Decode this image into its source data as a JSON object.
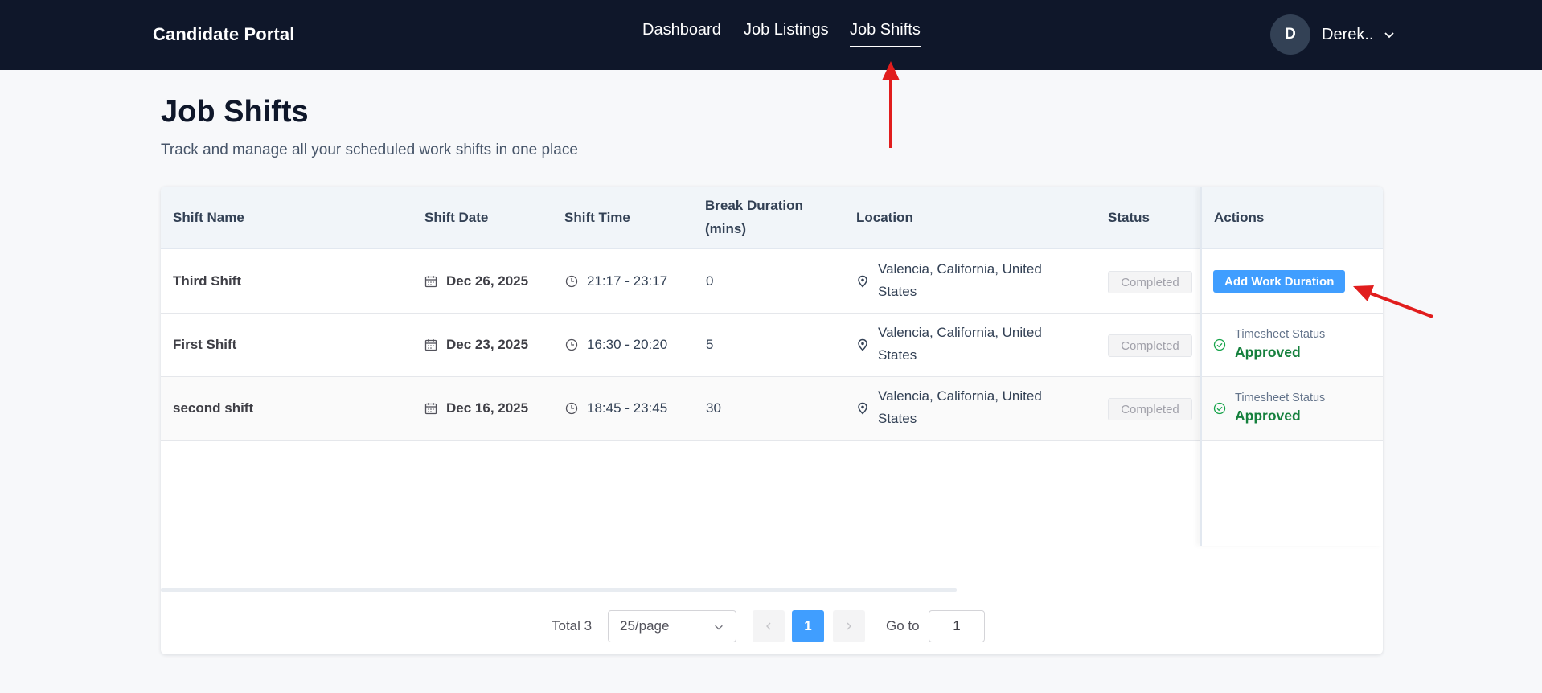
{
  "header": {
    "brand": "Candidate Portal",
    "nav": [
      {
        "label": "Dashboard",
        "active": false
      },
      {
        "label": "Job Listings",
        "active": false
      },
      {
        "label": "Job Shifts",
        "active": true
      }
    ],
    "user": {
      "initial": "D",
      "name": "Derek.."
    }
  },
  "page": {
    "title": "Job Shifts",
    "subtitle": "Track and manage all your scheduled work shifts in one place"
  },
  "table": {
    "columns": {
      "shift_name": "Shift Name",
      "shift_date": "Shift Date",
      "shift_time": "Shift Time",
      "break_duration_line1": "Break Duration",
      "break_duration_line2": "(mins)",
      "location": "Location",
      "status": "Status",
      "actions": "Actions"
    },
    "rows": [
      {
        "name": "Third Shift",
        "date": "Dec 26, 2025",
        "time": "21:17 - 23:17",
        "break": "0",
        "location_line1": "Valencia, California, United",
        "location_line2": "States",
        "status": "Completed",
        "action_button": "Add Work Duration"
      },
      {
        "name": "First Shift",
        "date": "Dec 23, 2025",
        "time": "16:30 - 20:20",
        "break": "5",
        "location_line1": "Valencia, California, United",
        "location_line2": "States",
        "status": "Completed",
        "timesheet_label": "Timesheet Status",
        "timesheet_value": "Approved"
      },
      {
        "name": "second shift",
        "date": "Dec 16, 2025",
        "time": "18:45 - 23:45",
        "break": "30",
        "location_line1": "Valencia, California, United",
        "location_line2": "States",
        "status": "Completed",
        "timesheet_label": "Timesheet Status",
        "timesheet_value": "Approved"
      }
    ]
  },
  "pagination": {
    "total": "Total 3",
    "page_size": "25/page",
    "current_page": "1",
    "goto_label": "Go to",
    "goto_value": "1"
  },
  "colors": {
    "header_bg": "#0f172a",
    "primary": "#409eff",
    "approved": "#15803d",
    "annotation_arrow": "#e11d1d"
  },
  "annotations": [
    "arrow-to-job-shifts-tab",
    "arrow-to-add-work-duration-button"
  ]
}
